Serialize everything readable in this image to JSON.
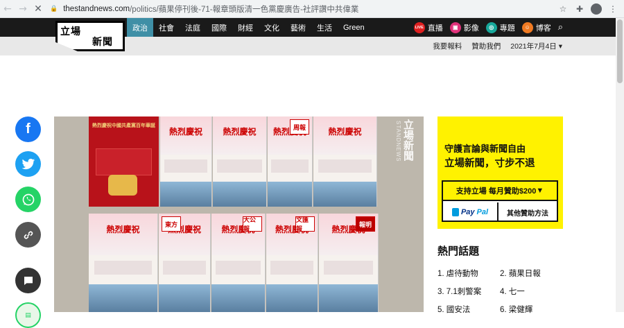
{
  "browser": {
    "url_host": "thestandnews.com",
    "url_path": "/politics/蘋果停刊後-71-報章頭版清一色黨慶廣告-社評讚中共偉業"
  },
  "logo": {
    "line1": "立場",
    "line2": "新聞"
  },
  "nav": {
    "items": [
      {
        "label": "政治",
        "active": true
      },
      {
        "label": "社會"
      },
      {
        "label": "法庭"
      },
      {
        "label": "國際"
      },
      {
        "label": "財經"
      },
      {
        "label": "文化"
      },
      {
        "label": "藝術"
      },
      {
        "label": "生活"
      },
      {
        "label": "Green"
      }
    ],
    "right": [
      {
        "badge": "LIVE",
        "label": "直播",
        "color": "#e02020"
      },
      {
        "label": "影像",
        "color": "#e0317a"
      },
      {
        "label": "專題",
        "color": "#17a89a"
      },
      {
        "label": "博客",
        "color": "#f07a22"
      }
    ]
  },
  "util": {
    "report": "我要報料",
    "support": "贊助我們",
    "date": "2021年7月4日"
  },
  "image": {
    "watermark": "立場新聞",
    "watermark_en": "STANDNEWS",
    "red_paper_headline": "熱烈慶祝中國共產黨百年華誕",
    "headline": "熱烈慶祝",
    "mastheads": [
      "周報",
      "大公報",
      "文匯報",
      "東方",
      "報明"
    ]
  },
  "ad": {
    "line1": "守護言論與新聞自由",
    "line2": "立場新聞，寸步不退",
    "support_label": "支持立場 每月贊助$200",
    "paypal_pay": "Pay",
    "paypal_pal": "Pal",
    "other_label": "其他贊助方法"
  },
  "hot_topics": {
    "title": "熱門話題",
    "items": [
      "1. 虐待動物",
      "2. 蘋果日報",
      "3. 7.1刺警案",
      "4. 七一",
      "5. 國安法",
      "6. 梁健輝"
    ]
  }
}
